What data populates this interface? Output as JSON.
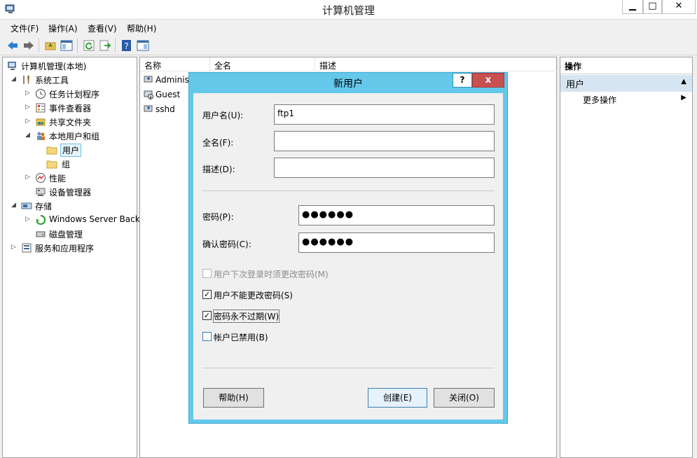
{
  "window": {
    "title": "计算机管理"
  },
  "menu": [
    "文件(F)",
    "操作(A)",
    "查看(V)",
    "帮助(H)"
  ],
  "tree": [
    {
      "label": "计算机管理(本地)",
      "expand": "",
      "icon": "computer-management-icon"
    },
    {
      "label": "系统工具",
      "expand": "◢",
      "icon": "tools-icon"
    },
    {
      "label": "任务计划程序",
      "expand": "▷",
      "icon": "clock-icon"
    },
    {
      "label": "事件查看器",
      "expand": "▷",
      "icon": "event-viewer-icon"
    },
    {
      "label": "共享文件夹",
      "expand": "▷",
      "icon": "shared-folder-icon"
    },
    {
      "label": "本地用户和组",
      "expand": "◢",
      "icon": "users-group-icon"
    },
    {
      "label": "用户",
      "expand": "",
      "icon": "folder-icon"
    },
    {
      "label": "组",
      "expand": "",
      "icon": "folder-icon"
    },
    {
      "label": "性能",
      "expand": "▷",
      "icon": "performance-icon"
    },
    {
      "label": "设备管理器",
      "expand": "",
      "icon": "device-manager-icon"
    },
    {
      "label": "存储",
      "expand": "◢",
      "icon": "storage-icon"
    },
    {
      "label": "Windows Server Back",
      "expand": "▷",
      "icon": "backup-icon"
    },
    {
      "label": "磁盘管理",
      "expand": "",
      "icon": "disk-icon"
    },
    {
      "label": "服务和应用程序",
      "expand": "▷",
      "icon": "services-icon"
    }
  ],
  "list": {
    "columns": [
      "名称",
      "全名",
      "描述"
    ],
    "rows": [
      "Administ",
      "Guest",
      "sshd"
    ]
  },
  "actions": {
    "title": "操作",
    "section": "用户",
    "item": "更多操作"
  },
  "dialog": {
    "title": "新用户",
    "help_btn": "?",
    "close_btn": "x",
    "username_label": "用户名(U):",
    "username_value": "ftp1",
    "fullname_label": "全名(F):",
    "fullname_value": "",
    "desc_label": "描述(D):",
    "desc_value": "",
    "password_label": "密码(P):",
    "password_value": "●●●●●●",
    "confirm_label": "确认密码(C):",
    "confirm_value": "●●●●●●",
    "chk_must_change": {
      "label": "用户下次登录时须更改密码(M)",
      "checked": false,
      "enabled": false
    },
    "chk_cannot_change": {
      "label": "用户不能更改密码(S)",
      "checked": true
    },
    "chk_never_expires": {
      "label": "密码永不过期(W)",
      "checked": true
    },
    "chk_disabled": {
      "label": "帐户已禁用(B)",
      "checked": false
    },
    "help_button": "帮助(H)",
    "create_button": "创建(E)",
    "close_button": "关闭(O)"
  }
}
